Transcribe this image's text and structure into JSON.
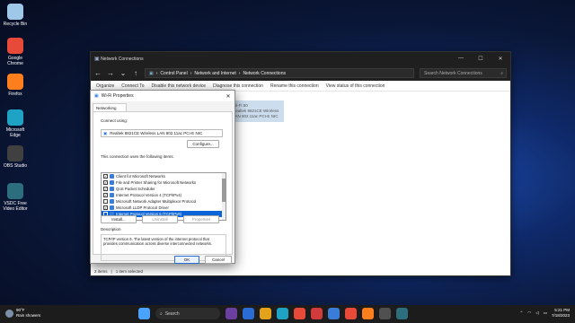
{
  "desktop": {
    "icons": [
      {
        "label": "Recycle Bin",
        "color": "#9fc8e8"
      },
      {
        "label": "Google Chrome",
        "color": "#e84a3a"
      },
      {
        "label": "Firefox",
        "color": "#ff7f1f"
      },
      {
        "label": "Microsoft Edge",
        "color": "#1fa3c4"
      },
      {
        "label": "OBS Studio",
        "color": "#404040"
      },
      {
        "label": "VSDC Free Video Editor",
        "color": "#2d6e7e"
      }
    ]
  },
  "explorer": {
    "title": "Network Connections",
    "path": [
      "Control Panel",
      "Network and Internet",
      "Network Connections"
    ],
    "search_placeholder": "Search Network Connections",
    "commands": [
      "Organize",
      "Connect To",
      "Disable this network device",
      "Diagnose this connection",
      "Rename this connection",
      "View status of this connection"
    ],
    "item_line1": "Wi-Fi 50",
    "item_line2": "Realtek 8821CE Wireless LAN 802.11ac PCI-E NIC",
    "status_items": "2 items",
    "status_selected": "1 item selected"
  },
  "dialog": {
    "title": "Wi-Fi Properties",
    "tab": "Networking",
    "connect_using_label": "Connect using:",
    "adapter": "Realtek 8821CE Wireless LAN 802.11ac PCI-E NIC",
    "configure_button": "Configure...",
    "items_label": "This connection uses the following items:",
    "items": [
      {
        "label": "Client for Microsoft Networks",
        "checked": true
      },
      {
        "label": "File and Printer Sharing for Microsoft Networks",
        "checked": true
      },
      {
        "label": "QoS Packet Scheduler",
        "checked": true
      },
      {
        "label": "Internet Protocol Version 4 (TCP/IPv4)",
        "checked": true
      },
      {
        "label": "Microsoft Network Adapter Multiplexor Protocol",
        "checked": false
      },
      {
        "label": "Microsoft LLDP Protocol Driver",
        "checked": true
      },
      {
        "label": "Internet Protocol Version 6 (TCP/IPv6)",
        "checked": false,
        "selected": true
      }
    ],
    "install_button": "Install...",
    "uninstall_button": "Uninstall",
    "properties_button": "Properties",
    "description_label": "Description",
    "description_text": "TCP/IP version 6. The latest version of the internet protocol that provides communication across diverse interconnected networks.",
    "ok_button": "OK",
    "cancel_button": "Cancel"
  },
  "taskbar": {
    "temp": "90°F",
    "weather": "Rain showers",
    "search_label": "Search",
    "time": "5:21 PM",
    "date": "7/18/2023"
  }
}
